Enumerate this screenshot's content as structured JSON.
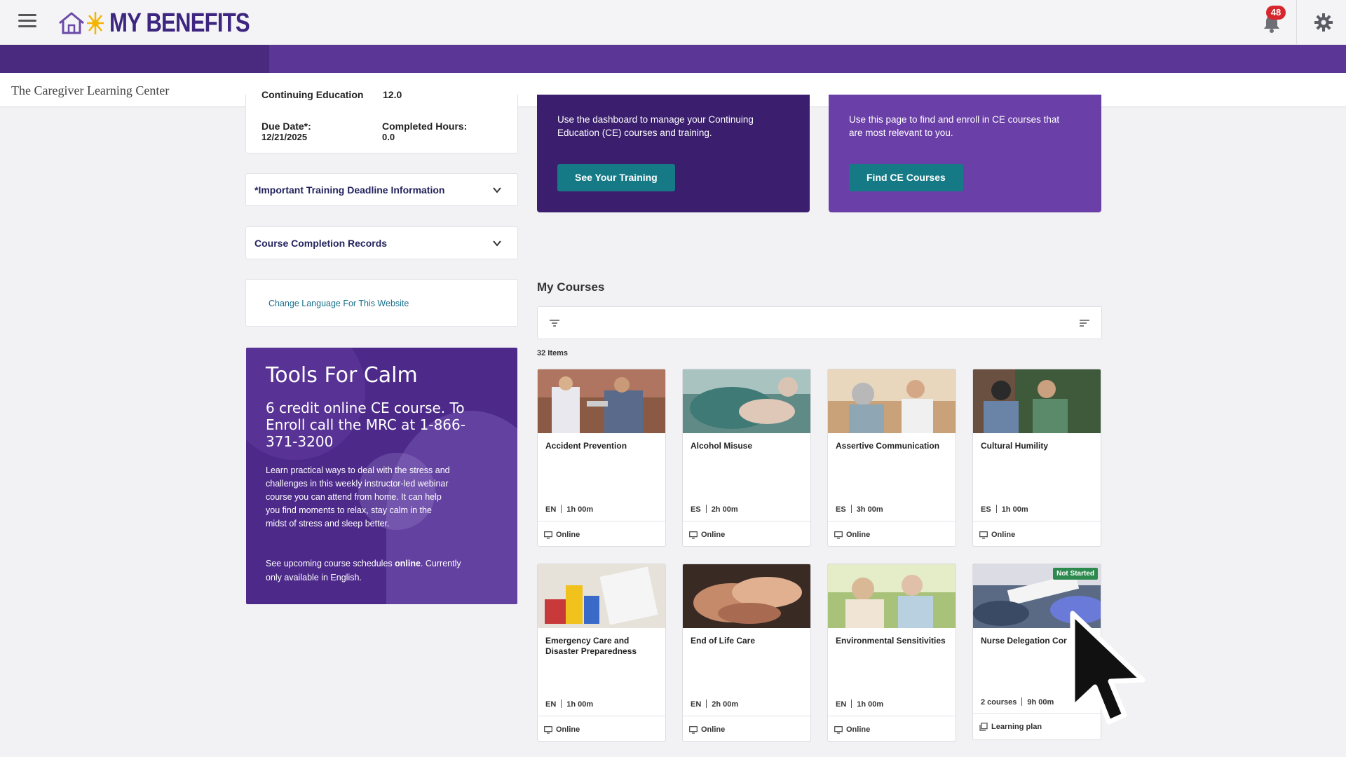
{
  "header": {
    "logo_text": "MY BENEFITS",
    "notification_count": "48"
  },
  "subheader": {
    "title": "The Caregiver Learning Center"
  },
  "ce_summary": {
    "partial_label": "Continuing Education",
    "partial_value": "12.0",
    "due_label": "Due Date*:",
    "due_value": "12/21/2025",
    "completed_label": "Completed Hours:",
    "completed_value": "0.0"
  },
  "accordions": [
    {
      "title": "*Important Training Deadline Information"
    },
    {
      "title": "Course Completion Records"
    }
  ],
  "language_link": "Change Language For This Website",
  "promo": {
    "title": "Tools For Calm",
    "subtitle": "6 credit online CE course. To Enroll call the MRC at 1-866-371-3200",
    "body": "Learn practical ways to deal with the stress and challenges in this weekly instructor-led webinar course you can attend from home. It can help you find moments to relax, stay calm in the midst of stress and sleep better.",
    "footer_pre": "See upcoming course schedules ",
    "footer_link": "online",
    "footer_post": ". Currently only available in English."
  },
  "hero_training": {
    "text": "Use the dashboard to manage your Continuing Education (CE) courses and training.",
    "button": "See Your Training"
  },
  "hero_find": {
    "text": "Use this page to find and enroll in CE courses that are most relevant to you.",
    "button": "Find CE Courses"
  },
  "my_courses": {
    "title": "My Courses",
    "items_count": "32 Items",
    "courses": [
      {
        "title": "Accident Prevention",
        "lang": "EN",
        "duration": "1h 00m",
        "mode": "Online"
      },
      {
        "title": "Alcohol Misuse",
        "lang": "ES",
        "duration": "2h 00m",
        "mode": "Online"
      },
      {
        "title": "Assertive Communication",
        "lang": "ES",
        "duration": "3h 00m",
        "mode": "Online"
      },
      {
        "title": "Cultural Humility",
        "lang": "ES",
        "duration": "1h 00m",
        "mode": "Online"
      },
      {
        "title": "Emergency Care and Disaster Preparedness",
        "lang": "EN",
        "duration": "1h 00m",
        "mode": "Online"
      },
      {
        "title": "End of Life Care",
        "lang": "EN",
        "duration": "2h 00m",
        "mode": "Online"
      },
      {
        "title": "Environmental Sensitivities",
        "lang": "EN",
        "duration": "1h 00m",
        "mode": "Online"
      },
      {
        "title": "Nurse Delegation Cor",
        "lang": "2 courses",
        "duration": "9h 00m",
        "mode": "Learning plan",
        "status": "Not Started"
      }
    ]
  }
}
